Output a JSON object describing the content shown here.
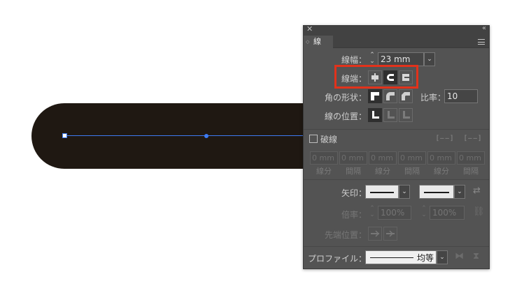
{
  "panel": {
    "close_glyph": "✕",
    "collapse_glyph": "‹‹",
    "tab_label": "線",
    "tab_arrows": "◇",
    "stroke_weight": {
      "label": "線幅：",
      "value": "23 mm",
      "spin": "⌃\n⌄",
      "dropdown": "⌄"
    },
    "cap": {
      "label": "線端：",
      "selected": "round-cap"
    },
    "corner": {
      "label": "角の形状：",
      "limit_label": "比率：",
      "limit_value": "10"
    },
    "align": {
      "label": "線の位置："
    },
    "dashed": {
      "label": "破線",
      "checked": false
    },
    "dash_fields": [
      {
        "value": "0 mm",
        "caption": "線分"
      },
      {
        "value": "0 mm",
        "caption": "間隔"
      },
      {
        "value": "0 mm",
        "caption": "線分"
      },
      {
        "value": "0 mm",
        "caption": "間隔"
      },
      {
        "value": "0 mm",
        "caption": "線分"
      },
      {
        "value": "0 mm",
        "caption": "間隔"
      }
    ],
    "arrows": {
      "label": "矢印：",
      "dropdown": "⌄"
    },
    "scale": {
      "label": "倍率：",
      "start": "100%",
      "end": "100%"
    },
    "align_arrow": {
      "label": "先端位置："
    },
    "profile": {
      "label": "プロファイル：",
      "value": "均等",
      "dropdown": "⌄"
    }
  },
  "colors": {
    "stroke": "#1f1812",
    "path": "#3d7bf3",
    "highlight": "#e2321b",
    "panel": "#535353"
  }
}
